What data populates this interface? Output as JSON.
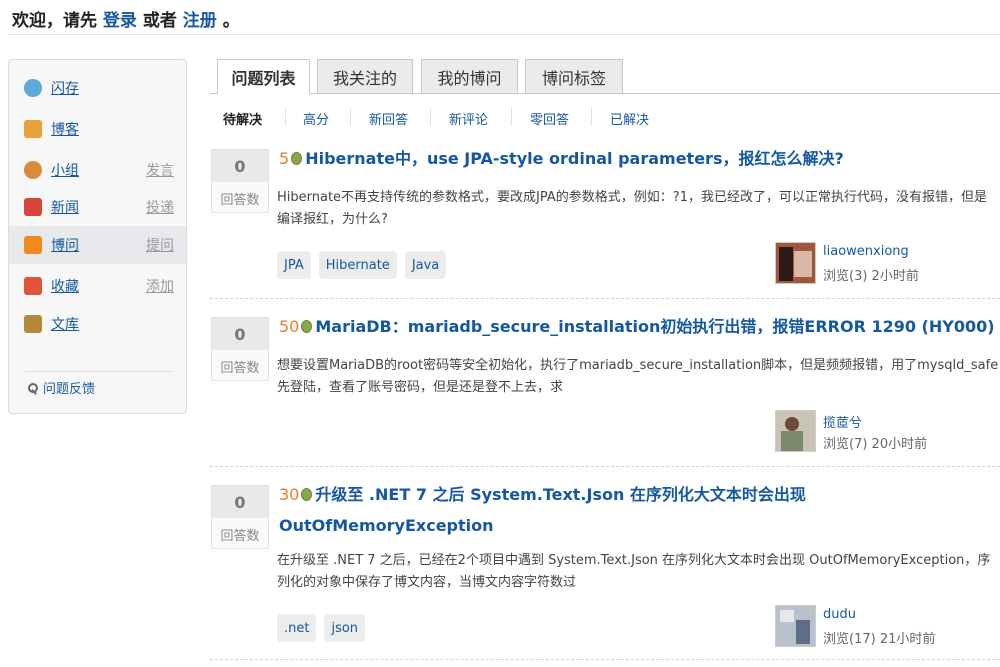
{
  "header": {
    "welcome_prefix": "欢迎，请先",
    "login_label": "登录",
    "or_label": "或者",
    "register_label": "注册",
    "welcome_suffix": "。"
  },
  "sidebar": {
    "items": [
      {
        "label": "闪存",
        "action": "",
        "icon": "chat-bubble-icon",
        "color": "#5fa8d8"
      },
      {
        "label": "博客",
        "action": "",
        "icon": "notebook-pencil-icon",
        "color": "#e8a23a"
      },
      {
        "label": "小组",
        "action": "发言",
        "icon": "group-people-icon",
        "color": "#d98b3a"
      },
      {
        "label": "新闻",
        "action": "投递",
        "icon": "newspaper-icon",
        "color": "#d9453c"
      },
      {
        "label": "博问",
        "action": "提问",
        "icon": "question-q-icon",
        "color": "#f08a1c"
      },
      {
        "label": "收藏",
        "action": "添加",
        "icon": "bookmark-heart-icon",
        "color": "#e2543a"
      },
      {
        "label": "文库",
        "action": "",
        "icon": "open-book-icon",
        "color": "#b48a3a"
      }
    ],
    "feedback_label": "问题反馈"
  },
  "tabs": [
    "问题列表",
    "我关注的",
    "我的博问",
    "博问标签"
  ],
  "subtabs": [
    "待解决",
    "高分",
    "新回答",
    "新评论",
    "零回答",
    "已解决"
  ],
  "answers_label": "回答数",
  "questions": [
    {
      "answers": "0",
      "reward": "5",
      "title": "Hibernate中，use JPA-style ordinal parameters，报红怎么解决?",
      "body": "Hibernate不再支持传统的参数格式，要改成JPA的参数格式，例如：?1，我已经改了，可以正常执行代码，没有报错，但是编译报红，为什么?",
      "tags": [
        "JPA",
        "Hibernate",
        "Java"
      ],
      "user": "liaowenxiong",
      "meta": "浏览(3) 2小时前"
    },
    {
      "answers": "0",
      "reward": "50",
      "title": "MariaDB：mariadb_secure_installation初始执行出错，报错ERROR 1290 (HY000)",
      "body": "想要设置MariaDB的root密码等安全初始化，执行了mariadb_secure_installation脚本，但是频频报错，用了mysqld_safe先登陆，查看了账号密码，但是还是登不上去，求",
      "tags": [],
      "user": "揽茝兮",
      "meta": "浏览(7) 20小时前"
    },
    {
      "answers": "0",
      "reward": "30",
      "title": "升级至 .NET 7 之后 System.Text.Json 在序列化大文本时会出现 OutOfMemoryException",
      "body": "在升级至 .NET 7 之后，已经在2个项目中遇到 System.Text.Json 在序列化大文本时会出现 OutOfMemoryException，序列化的对象中保存了博文内容，当博文内容字符数过",
      "tags": [
        ".net",
        "json"
      ],
      "user": "dudu",
      "meta": "浏览(17) 21小时前"
    }
  ],
  "colors": {
    "link": "#15589e",
    "reward": "#e47e29",
    "bean": "#8ba54a"
  }
}
